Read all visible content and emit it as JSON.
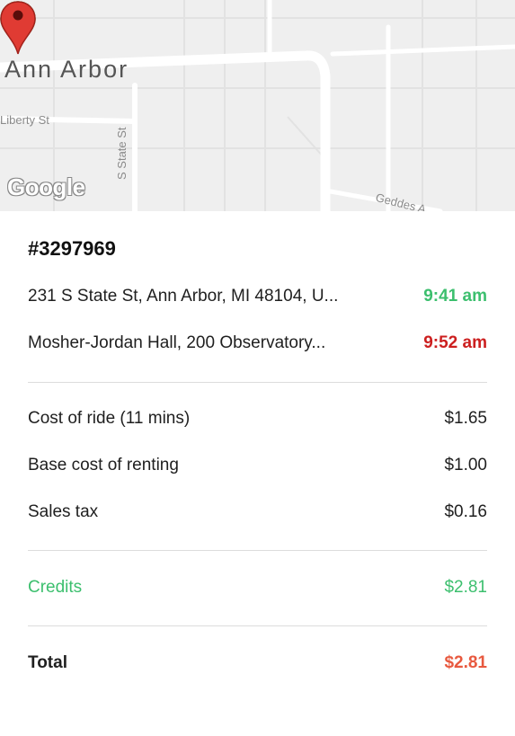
{
  "map": {
    "city_label": "Ann Arbor",
    "street_liberty": "Liberty St",
    "street_state": "S State St",
    "street_geddes": "Geddes A",
    "logo": "Google",
    "start_pin_color": "#2fa83a",
    "end_pin_color": "#e03b33",
    "start_pin_icon": "map-pin-green-icon",
    "end_pin_icon": "map-pin-red-icon"
  },
  "trip": {
    "id": "#3297969",
    "start_address": "231 S State St, Ann Arbor, MI 48104, U...",
    "start_time": "9:41 am",
    "end_address": "Mosher-Jordan Hall, 200 Observatory...",
    "end_time": "9:52 am"
  },
  "costs": [
    {
      "label": "Cost of ride (11 mins)",
      "value": "$1.65"
    },
    {
      "label": "Base cost of renting",
      "value": "$1.00"
    },
    {
      "label": "Sales tax",
      "value": "$0.16"
    }
  ],
  "credits": {
    "label": "Credits",
    "value": "$2.81"
  },
  "total": {
    "label": "Total",
    "value": "$2.81"
  },
  "colors": {
    "green_accent": "#3cbf6e",
    "red_accent": "#cc1f1f",
    "total_accent": "#e8593f"
  }
}
